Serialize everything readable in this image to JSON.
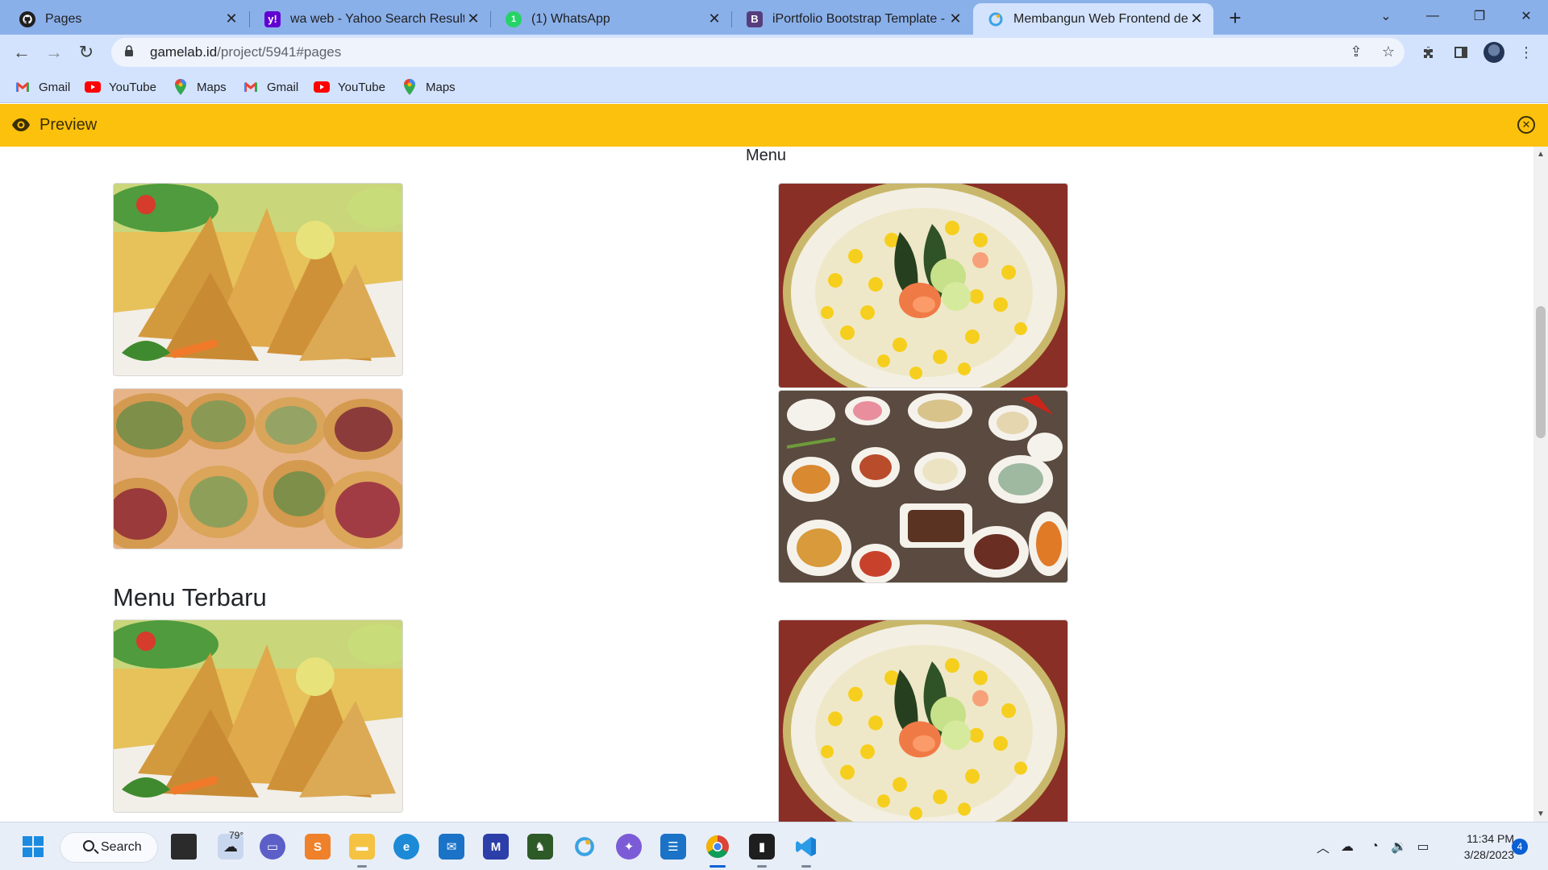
{
  "browser": {
    "tabs": [
      {
        "label": "Pages",
        "icon": "github-icon",
        "active": false
      },
      {
        "label": "wa web - Yahoo Search Results",
        "icon": "yahoo-icon",
        "active": false
      },
      {
        "label": "(1) WhatsApp",
        "icon": "whatsapp-icon",
        "active": false
      },
      {
        "label": "iPortfolio Bootstrap Template - In",
        "icon": "bootstrap-icon",
        "active": false
      },
      {
        "label": "Membangun Web Frontend deng",
        "icon": "gamelab-icon",
        "active": true
      }
    ],
    "address": {
      "host": "gamelab.id",
      "path": "/project/5941#pages"
    },
    "bookmarks": [
      {
        "label": "Gmail",
        "icon": "gmail-icon"
      },
      {
        "label": "YouTube",
        "icon": "youtube-icon"
      },
      {
        "label": "Maps",
        "icon": "maps-icon"
      },
      {
        "label": "Gmail",
        "icon": "gmail-icon"
      },
      {
        "label": "YouTube",
        "icon": "youtube-icon"
      },
      {
        "label": "Maps",
        "icon": "maps-icon"
      }
    ]
  },
  "preview_bar": {
    "label": "Preview",
    "color": "#fcc10d"
  },
  "page": {
    "menu_heading": "Menu",
    "section_title": "Menu Terbaru",
    "images": [
      {
        "name": "samosa-image",
        "dish": "samosa"
      },
      {
        "name": "bubur-jagung-image",
        "dish": "corn soup"
      },
      {
        "name": "kue-sosis-image",
        "dish": "savory tarts"
      },
      {
        "name": "nasi-padang-image",
        "dish": "padang spread"
      },
      {
        "name": "samosa-image-2",
        "dish": "samosa"
      },
      {
        "name": "bubur-jagung-image-2",
        "dish": "corn soup"
      }
    ]
  },
  "taskbar": {
    "search_label": "Search",
    "weather": "79°",
    "time": "11:34 PM",
    "date": "3/28/2023",
    "notifications": "4"
  }
}
